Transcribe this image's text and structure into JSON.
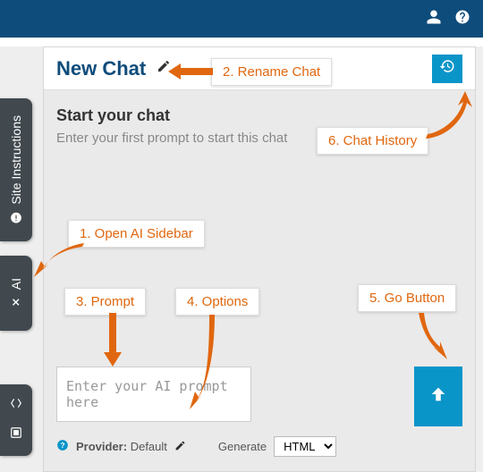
{
  "topbar": {
    "icons": [
      "user",
      "help"
    ]
  },
  "sideTabs": {
    "siteInstructions": "Site Instructions",
    "ai": "AI"
  },
  "chat": {
    "title": "New Chat",
    "startHeading": "Start your chat",
    "startHint": "Enter your first prompt to start this chat",
    "promptPlaceholder": "Enter your AI prompt here",
    "providerLabel": "Provider:",
    "providerValue": "Default",
    "generateLabel": "Generate",
    "generateSelected": "HTML"
  },
  "annotations": {
    "a1": "1. Open AI Sidebar",
    "a2": "2. Rename Chat",
    "a3": "3. Prompt",
    "a4": "4. Options",
    "a5": "5. Go Button",
    "a6": "6. Chat History"
  }
}
